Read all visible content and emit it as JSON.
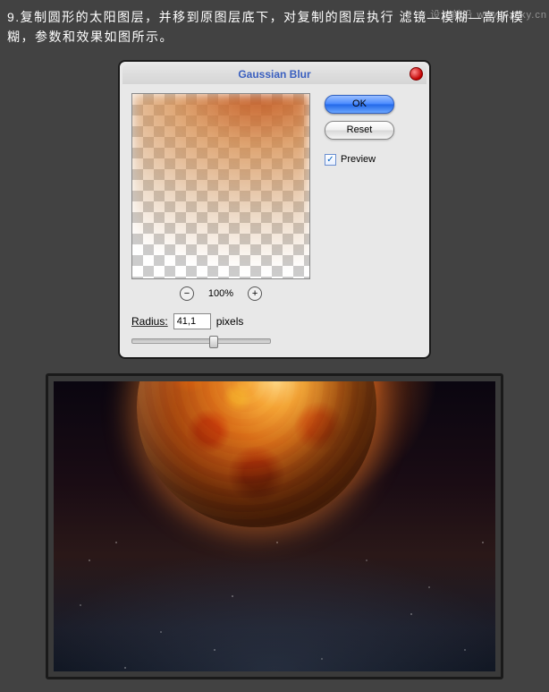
{
  "instruction": "9.复制圆形的太阳图层，并移到原图层底下，对复制的图层执行 滤镜—模糊—高斯模糊，参数和效果如图所示。",
  "watermark": "设计前沿 wwwwzsky.cn",
  "dialog": {
    "title": "Gaussian Blur",
    "ok": "OK",
    "reset": "Reset",
    "preview_label": "Preview",
    "zoom": "100%",
    "zoom_minus": "−",
    "zoom_plus": "+",
    "radius_label": "Radius:",
    "radius_value": "41,1",
    "radius_unit": "pixels",
    "check": "✓"
  }
}
